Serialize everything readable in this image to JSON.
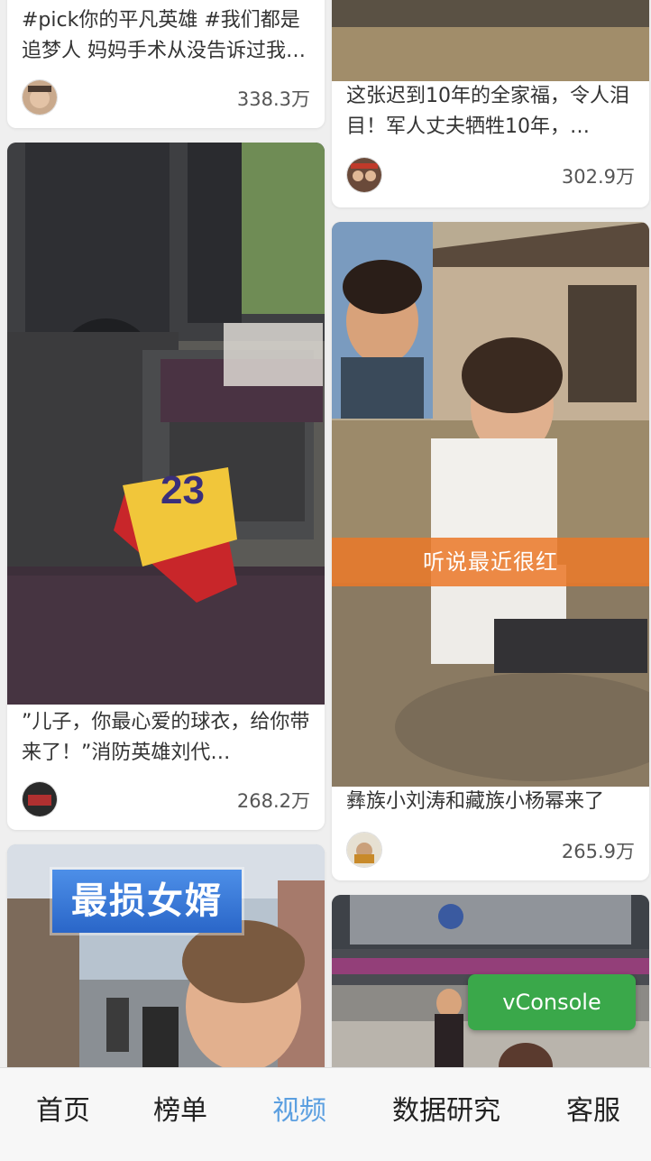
{
  "feed": {
    "left": [
      {
        "title": "#pick你的平凡英雄 #我们都是追梦人 妈妈手术从没告诉过我…",
        "views": "338.3万"
      },
      {
        "title": "”儿子，你最心爱的球衣，给你带来了！”消防英雄刘代…",
        "views": "268.2万",
        "jersey_number": "23"
      },
      {
        "caption": "最损女婿"
      }
    ],
    "right": [
      {
        "title": "这张迟到10年的全家福，令人泪目！军人丈夫牺牲10年，…",
        "views": "302.9万"
      },
      {
        "title": "彝族小刘涛和藏族小杨幂来了",
        "views": "265.9万",
        "overlay_text": "听说最近很红"
      },
      {}
    ]
  },
  "vconsole": {
    "label": "vConsole"
  },
  "tabbar": {
    "tabs": [
      {
        "label": "首页",
        "active": false
      },
      {
        "label": "榜单",
        "active": false
      },
      {
        "label": "视频",
        "active": true
      },
      {
        "label": "数据研究",
        "active": false
      },
      {
        "label": "客服",
        "active": false
      }
    ],
    "active_color": "#5b9fe0"
  }
}
